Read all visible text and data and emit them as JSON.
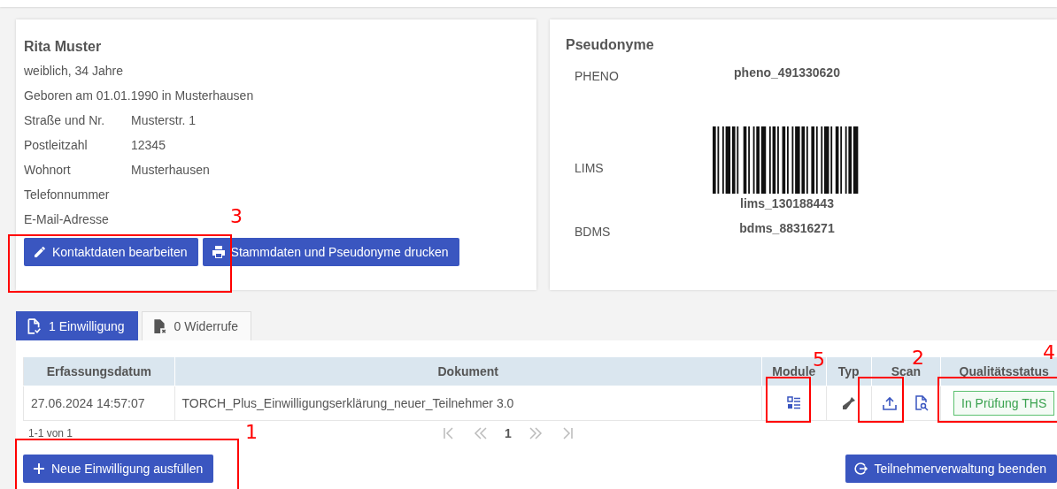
{
  "person": {
    "name": "Rita Muster",
    "summary": "weiblich, 34 Jahre",
    "birth": "Geboren am 01.01.1990 in Musterhausen",
    "fields": [
      {
        "label": "Straße und Nr.",
        "value": "Musterstr. 1"
      },
      {
        "label": "Postleitzahl",
        "value": "12345"
      },
      {
        "label": "Wohnort",
        "value": "Musterhausen"
      },
      {
        "label": "Telefonnummer"
      },
      {
        "label": "E-Mail-Adresse"
      }
    ],
    "buttons": [
      {
        "kind": "edit",
        "label": "Kontaktdaten bearbeiten"
      },
      {
        "kind": "print",
        "label": "Stammdaten und Pseudonyme drucken"
      }
    ]
  },
  "pseudonyms": {
    "title": "Pseudonyme",
    "items": [
      {
        "label": "PHENO",
        "value": "pheno_491330620",
        "kind": "text"
      },
      {
        "label": "LIMS",
        "value": "lims_130188443",
        "kind": "barcode"
      },
      {
        "label": "BDMS",
        "value": "bdms_88316271",
        "kind": "text"
      }
    ]
  },
  "tabs": [
    {
      "label": "1 Einwilligung",
      "selected": true,
      "kind": "consent"
    },
    {
      "label": "0 Widerrufe",
      "selected": false,
      "kind": "revoke"
    }
  ],
  "table": {
    "columns": [
      "Erfassungsdatum",
      "Dokument",
      "Module",
      "Typ",
      "Scan",
      "Qualitätsstatus"
    ],
    "rows": [
      {
        "date": "27.06.2024 14:57:07",
        "document": "TORCH_Plus_Einwilligungserklärung_neuer_Teilnehmer 3.0",
        "status": "In Prüfung THS"
      }
    ]
  },
  "pagination": {
    "range": "1-1 von 1",
    "page": "1"
  },
  "actions": [
    {
      "kind": "add",
      "label": "Neue Einwilligung ausfüllen"
    },
    {
      "kind": "exit",
      "label": "Teilnehmerverwaltung beenden"
    }
  ],
  "annotations": [
    "3",
    "1",
    "5",
    "2",
    "4"
  ]
}
